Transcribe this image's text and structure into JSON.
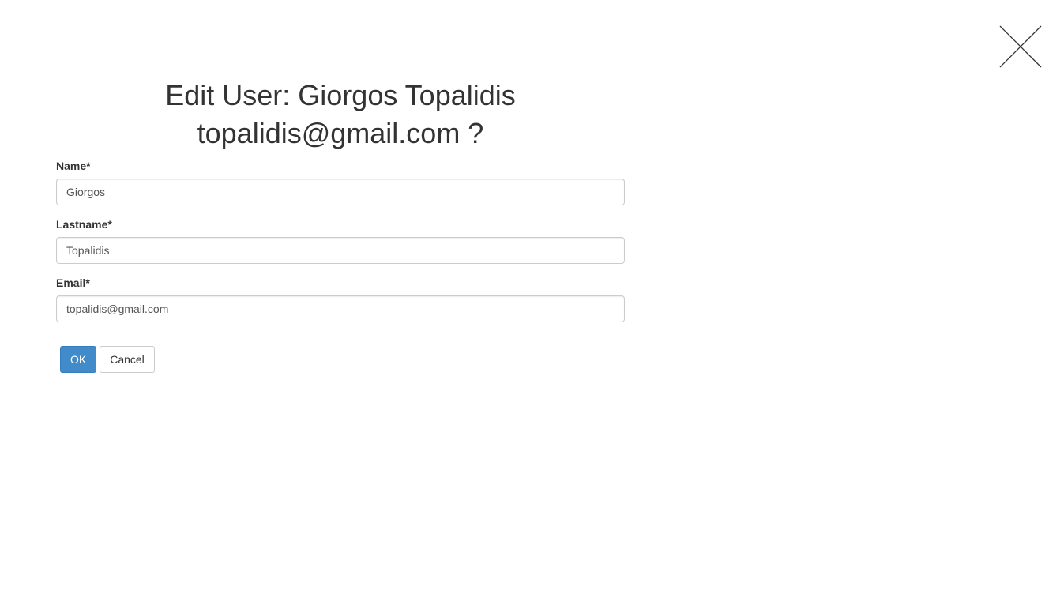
{
  "dialog": {
    "title": "Edit User: Giorgos Topalidis topalidis@gmail.com ?",
    "close_icon": "close-icon"
  },
  "form": {
    "name": {
      "label": "Name*",
      "value": "Giorgos"
    },
    "lastname": {
      "label": "Lastname*",
      "value": "Topalidis"
    },
    "email": {
      "label": "Email*",
      "value": "topalidis@gmail.com"
    }
  },
  "actions": {
    "ok_label": "OK",
    "cancel_label": "Cancel"
  },
  "colors": {
    "primary": "#428bca",
    "text": "#333333",
    "border": "#cccccc"
  }
}
